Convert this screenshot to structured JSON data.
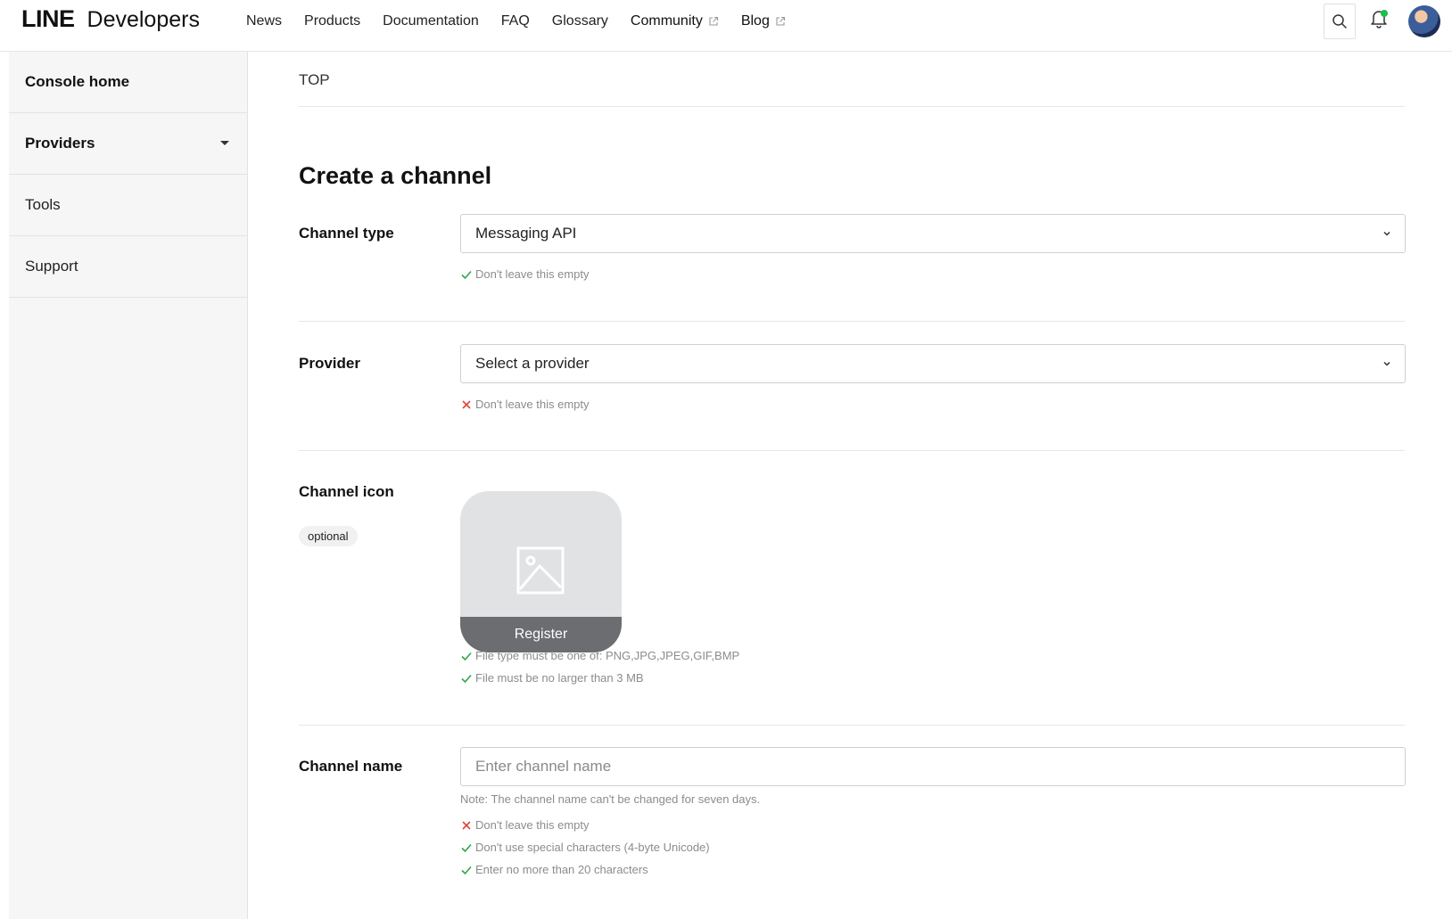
{
  "header": {
    "logo_line": "LINE",
    "logo_developers": "Developers",
    "nav": [
      {
        "label": "News",
        "external": false
      },
      {
        "label": "Products",
        "external": false
      },
      {
        "label": "Documentation",
        "external": false
      },
      {
        "label": "FAQ",
        "external": false
      },
      {
        "label": "Glossary",
        "external": false
      },
      {
        "label": "Community",
        "external": true
      },
      {
        "label": "Blog",
        "external": true
      }
    ],
    "icons": {
      "search": "search-icon",
      "notifications": "bell-icon",
      "avatar": "avatar"
    },
    "notification_dot_color": "#19c04b"
  },
  "sidebar": {
    "items": [
      {
        "label": "Console home"
      },
      {
        "label": "Providers"
      },
      {
        "label": "Tools"
      },
      {
        "label": "Support"
      }
    ]
  },
  "main": {
    "breadcrumb": "TOP",
    "title": "Create a channel",
    "channel_type": {
      "label": "Channel type",
      "value": "Messaging API",
      "hints": [
        {
          "status": "ok",
          "text": "Don't leave this empty"
        }
      ]
    },
    "provider": {
      "label": "Provider",
      "value": "Select a provider",
      "hints": [
        {
          "status": "error",
          "text": "Don't leave this empty"
        }
      ]
    },
    "channel_icon": {
      "label": "Channel icon",
      "optional_badge": "optional",
      "register_label": "Register",
      "hints": [
        {
          "status": "ok",
          "text": "File type must be one of: PNG,JPG,JPEG,GIF,BMP"
        },
        {
          "status": "ok",
          "text": "File must be no larger than 3 MB"
        }
      ]
    },
    "channel_name": {
      "label": "Channel name",
      "placeholder": "Enter channel name",
      "note": "Note: The channel name can't be changed for seven days.",
      "hints": [
        {
          "status": "error",
          "text": "Don't leave this empty"
        },
        {
          "status": "ok",
          "text": "Don't use special characters (4-byte Unicode)"
        },
        {
          "status": "ok",
          "text": "Enter no more than 20 characters"
        }
      ]
    }
  },
  "colors": {
    "ok": "#2aa84a",
    "error": "#e0453a"
  }
}
